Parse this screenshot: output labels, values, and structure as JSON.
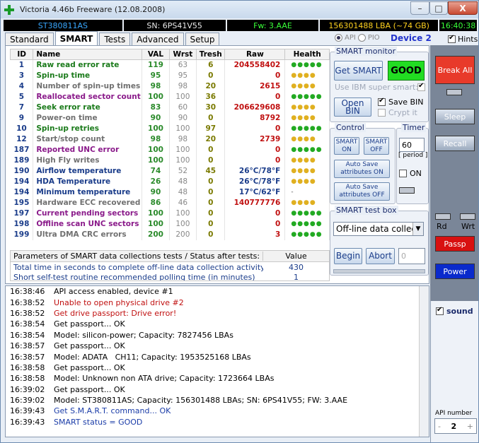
{
  "window": {
    "title": "Victoria 4.46b Freeware (12.08.2008)",
    "minimize": "–",
    "maximize": "□",
    "close": "X"
  },
  "infobar": {
    "model": "ST380811AS",
    "sn": "SN: 6PS41V55",
    "fw": "Fw: 3.AAE",
    "lba": "156301488 LBA (~74 GB)",
    "clock": "16:40:38"
  },
  "tabs": [
    {
      "label": "Standard"
    },
    {
      "label": "SMART"
    },
    {
      "label": "Tests"
    },
    {
      "label": "Advanced"
    },
    {
      "label": "Setup"
    }
  ],
  "header": {
    "api": "API",
    "pio": "PIO",
    "device": "Device 2",
    "hints": "Hints"
  },
  "table": {
    "columns": [
      "ID",
      "Name",
      "VAL",
      "Wrst",
      "Tresh",
      "Raw",
      "Health"
    ],
    "rows": [
      {
        "id": "1",
        "name": "Raw read error rate",
        "val": "119",
        "wrst": "63",
        "tresh": "6",
        "raw": "204558402",
        "health": "●●●●●",
        "nc": "#1a7a1a",
        "rc": "#c01010",
        "hc": "#22aa22"
      },
      {
        "id": "3",
        "name": "Spin-up time",
        "val": "95",
        "wrst": "95",
        "tresh": "0",
        "raw": "0",
        "health": "●●●●",
        "nc": "#1a7a1a",
        "rc": "#c01010",
        "hc": "#e0b020"
      },
      {
        "id": "4",
        "name": "Number of spin-up times",
        "val": "98",
        "wrst": "98",
        "tresh": "20",
        "raw": "2615",
        "health": "●●●●",
        "nc": "#707070",
        "rc": "#c01010",
        "hc": "#e0b020"
      },
      {
        "id": "5",
        "name": "Reallocated sector count",
        "val": "100",
        "wrst": "100",
        "tresh": "36",
        "raw": "0",
        "health": "●●●●●",
        "nc": "#8a1a8a",
        "rc": "#c01010",
        "hc": "#22aa22"
      },
      {
        "id": "7",
        "name": "Seek error rate",
        "val": "83",
        "wrst": "60",
        "tresh": "30",
        "raw": "206629608",
        "health": "●●●●",
        "nc": "#1a7a1a",
        "rc": "#c01010",
        "hc": "#e0b020"
      },
      {
        "id": "9",
        "name": "Power-on time",
        "val": "90",
        "wrst": "90",
        "tresh": "0",
        "raw": "8792",
        "health": "●●●●",
        "nc": "#707070",
        "rc": "#c01010",
        "hc": "#e0b020"
      },
      {
        "id": "10",
        "name": "Spin-up retries",
        "val": "100",
        "wrst": "100",
        "tresh": "97",
        "raw": "0",
        "health": "●●●●●",
        "nc": "#1a7a1a",
        "rc": "#c01010",
        "hc": "#22aa22"
      },
      {
        "id": "12",
        "name": "Start/stop count",
        "val": "98",
        "wrst": "98",
        "tresh": "20",
        "raw": "2739",
        "health": "●●●●",
        "nc": "#707070",
        "rc": "#c01010",
        "hc": "#e0b020"
      },
      {
        "id": "187",
        "name": "Reported UNC error",
        "val": "100",
        "wrst": "100",
        "tresh": "0",
        "raw": "0",
        "health": "●●●●●",
        "nc": "#8a1a8a",
        "rc": "#c01010",
        "hc": "#22aa22"
      },
      {
        "id": "189",
        "name": "High Fly writes",
        "val": "100",
        "wrst": "100",
        "tresh": "0",
        "raw": "0",
        "health": "●●●●",
        "nc": "#707070",
        "rc": "#c01010",
        "hc": "#e0b020"
      },
      {
        "id": "190",
        "name": "Airflow temperature",
        "val": "74",
        "wrst": "52",
        "tresh": "45",
        "raw": "26°C/78°F",
        "health": "●●●●",
        "nc": "#1a3c8a",
        "rc": "#1a3c8a",
        "hc": "#e0b020"
      },
      {
        "id": "194",
        "name": "HDA Temperature",
        "val": "26",
        "wrst": "48",
        "tresh": "0",
        "raw": "26°C/78°F",
        "health": "●●●●",
        "nc": "#1a3c8a",
        "rc": "#1a3c8a",
        "hc": "#e0b020"
      },
      {
        "id": "194",
        "name": "Minimum temperature",
        "val": "90",
        "wrst": "48",
        "tresh": "0",
        "raw": "17°C/62°F",
        "health": "-",
        "nc": "#1a3c8a",
        "rc": "#1a3c8a",
        "hc": "#555555"
      },
      {
        "id": "195",
        "name": "Hardware ECC recovered",
        "val": "86",
        "wrst": "46",
        "tresh": "0",
        "raw": "140777776",
        "health": "●●●●",
        "nc": "#707070",
        "rc": "#c01010",
        "hc": "#e0b020"
      },
      {
        "id": "197",
        "name": "Current pending sectors",
        "val": "100",
        "wrst": "100",
        "tresh": "0",
        "raw": "0",
        "health": "●●●●●",
        "nc": "#8a1a8a",
        "rc": "#c01010",
        "hc": "#22aa22"
      },
      {
        "id": "198",
        "name": "Offline scan UNC sectors",
        "val": "100",
        "wrst": "100",
        "tresh": "0",
        "raw": "0",
        "health": "●●●●●",
        "nc": "#8a1a8a",
        "rc": "#c01010",
        "hc": "#22aa22"
      },
      {
        "id": "199",
        "name": "Ultra DMA CRC errors",
        "val": "200",
        "wrst": "200",
        "tresh": "0",
        "raw": "3",
        "health": "●●●●●",
        "nc": "#707070",
        "rc": "#c01010",
        "hc": "#22aa22"
      }
    ]
  },
  "params": {
    "header": "Parameters of SMART data collections tests / Status after tests:",
    "value_header": "Value",
    "rows": [
      {
        "label": "Total time in seconds to complete off-line data collection activity",
        "value": "430"
      },
      {
        "label": "Short self-test routine recommended polling time (in minutes)",
        "value": "1"
      }
    ]
  },
  "smart_monitor": {
    "title": "SMART monitor",
    "get_smart": "Get SMART",
    "status": "GOOD",
    "ibm": "Use IBM super smart:",
    "open_bin": "Open BIN",
    "save_bin": "Save BIN",
    "crypt": "Crypt it"
  },
  "control": {
    "title": "Control",
    "smart_on": "SMART ON",
    "smart_off": "SMART OFF",
    "autosave_on": "Auto Save attributes ON",
    "autosave_off": "Auto Save attributes OFF"
  },
  "timer": {
    "title": "Timer",
    "value": "60",
    "period": "[ period ]",
    "on": "ON"
  },
  "test_box": {
    "title": "SMART test box",
    "selected": "Off-line data collect",
    "begin": "Begin",
    "abort": "Abort",
    "count": "0"
  },
  "right": {
    "break_all": "Break All",
    "sleep": "Sleep",
    "recall": "Recall",
    "rd": "Rd",
    "wrt": "Wrt",
    "passp": "Passp",
    "power": "Power",
    "sound": "sound",
    "api_number": "API number",
    "api_value": "2",
    "minus": "-",
    "plus": "+"
  },
  "log": [
    {
      "time": "16:38:46",
      "msg": "API access enabled, device #1",
      "color": "#000000"
    },
    {
      "time": "16:38:52",
      "msg": "Unable to open physical drive #2",
      "color": "#c01010"
    },
    {
      "time": "16:38:52",
      "msg": "Get drive passport: Drive error!",
      "color": "#c01010"
    },
    {
      "time": "16:38:54",
      "msg": "Get passport... OK",
      "color": "#000000"
    },
    {
      "time": "16:38:54",
      "msg": "Model: silicon-power; Capacity: 7827456 LBAs",
      "color": "#000000"
    },
    {
      "time": "16:38:57",
      "msg": "Get passport... OK",
      "color": "#000000"
    },
    {
      "time": "16:38:57",
      "msg": "Model: ADATA   CH11; Capacity: 1953525168 LBAs",
      "color": "#000000"
    },
    {
      "time": "16:38:58",
      "msg": "Get passport... OK",
      "color": "#000000"
    },
    {
      "time": "16:38:58",
      "msg": "Model: Unknown non ATA drive; Capacity: 1723664 LBAs",
      "color": "#000000"
    },
    {
      "time": "16:39:02",
      "msg": "Get passport... OK",
      "color": "#000000"
    },
    {
      "time": "16:39:02",
      "msg": "Model: ST380811AS; Capacity: 156301488 LBAs; SN: 6PS41V55; FW: 3.AAE",
      "color": "#000000"
    },
    {
      "time": "16:39:43",
      "msg": "Get S.M.A.R.T. command... OK",
      "color": "#1a3ca8"
    },
    {
      "time": "16:39:43",
      "msg": "SMART status = GOOD",
      "color": "#1a3ca8"
    }
  ]
}
